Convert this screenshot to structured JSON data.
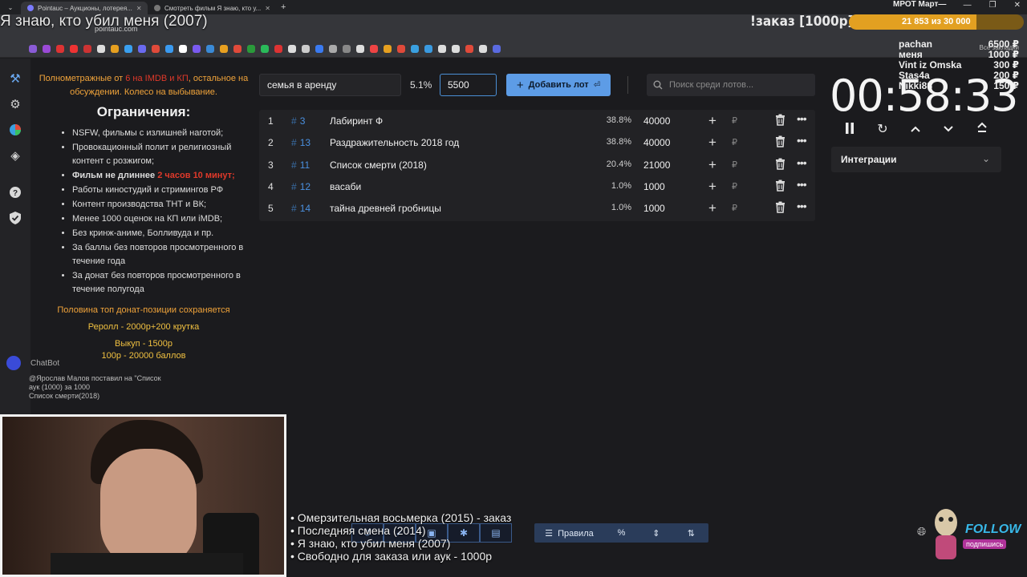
{
  "browser": {
    "tabs": [
      {
        "label": "Pointauc – Аукционы, лотерея..."
      },
      {
        "label": "Смотреть фильм Я знаю, кто у..."
      }
    ],
    "url": "pointauc.com",
    "bookmarks_right": "Все закладки"
  },
  "overlay": {
    "film_title": "Я знаю, кто убил меня (2007)",
    "order_title": "!заказ [1000р]",
    "goal_label": "МРОТ Март—",
    "goal_progress_text": "21 853  из 30 000",
    "goal_fraction": 0.728,
    "donors": [
      {
        "name": "pachan",
        "amount": "6500 ₽"
      },
      {
        "name": "меня",
        "amount": "1000 ₽"
      },
      {
        "name": "Vint iz Omska",
        "amount": "300 ₽"
      },
      {
        "name": "Stas4a",
        "amount": "200 ₽"
      },
      {
        "name": "Nikki88",
        "amount": "150 ₽"
      }
    ]
  },
  "rules": {
    "intro_a": "Полнометражные от ",
    "intro_red": "6 на IMDB и КП",
    "intro_b": ", остальное на обсуждении. Колесо на выбывание.",
    "heading": "Ограничения:",
    "items": [
      "NSFW, фильмы с излишней наготой;",
      "Провокационный полит и религиозный контент с розжигом;",
      "Работы киностудий и стримингов РФ",
      "Контент производства ТНТ и ВК;",
      "Менее 1000 оценок на КП или iMDB;",
      "Без кринж-аниме, Болливуда и пр.",
      "За баллы без повторов просмотренного в течение года",
      "За донат без повторов просмотренного в течение полугода"
    ],
    "duration_a": "Фильм не длиннее ",
    "duration_red": "2 часов 10 минут;",
    "note1": "Половина топ донат-позиции сохраняется",
    "note2": "Реролл - 2000р+200 крутка",
    "note3": "Выкуп - 1500р",
    "note4": "100р - 20000 баллов"
  },
  "chatbot": {
    "label": "ChatBot",
    "line1": "@Ярослав Малов поставил на \"Список",
    "line2": "аук (1000) за 1000",
    "line3": "Список смерти(2018)"
  },
  "form": {
    "lot_name": "семья в аренду",
    "percent": "5.1%",
    "amount": "5500",
    "add_label": "Добавить лот",
    "search_placeholder": "Поиск среди лотов..."
  },
  "lots": {
    "currency": "₽",
    "rows": [
      {
        "num": "1",
        "id": "3",
        "name": "Лабиринт Ф",
        "pct": "38.8%",
        "amount": "40000"
      },
      {
        "num": "2",
        "id": "13",
        "name": "Раздражительность 2018 год",
        "pct": "38.8%",
        "amount": "40000"
      },
      {
        "num": "3",
        "id": "11",
        "name": "Список смерти (2018)",
        "pct": "20.4%",
        "amount": "21000"
      },
      {
        "num": "4",
        "id": "12",
        "name": "васаби",
        "pct": "1.0%",
        "amount": "1000"
      },
      {
        "num": "5",
        "id": "14",
        "name": "тайна древней гробницы",
        "pct": "1.0%",
        "amount": "1000"
      }
    ]
  },
  "timer": {
    "value": "00:58:33",
    "integrations_label": "Интеграции"
  },
  "queue": {
    "lines": [
      "• Омерзительная восьмерка (2015) - заказ",
      "• Последняя смена (2014)",
      "• Я знаю, кто убил меня (2007)",
      "• Свободно для заказа или аук - 1000р"
    ]
  },
  "bottom": {
    "rules_label": "Правила",
    "follow": "FOLLOW",
    "subscribe": "подпишись"
  },
  "icons": [
    "gavel-icon",
    "gear-icon",
    "pie-chart-icon",
    "layers-icon",
    "help-icon",
    "shield-icon",
    "pause-icon",
    "restart-icon",
    "chevron-up-icon",
    "chevron-down-icon",
    "collapse-icon",
    "search-icon",
    "trash-icon",
    "more-icon"
  ],
  "colors": {
    "accent": "#5d9ce6",
    "warning": "#f0a33a",
    "danger": "#e0392a",
    "id_link": "#4a90e0"
  }
}
